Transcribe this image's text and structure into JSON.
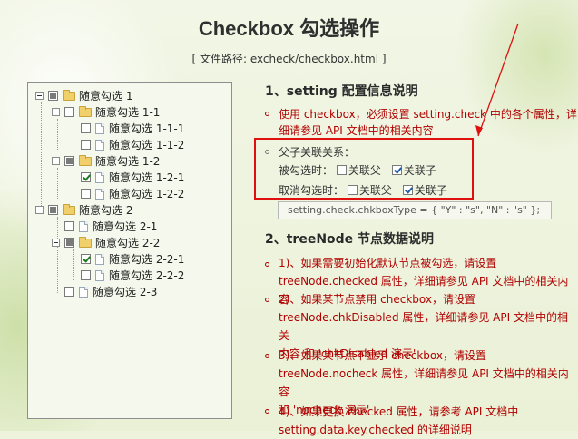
{
  "page": {
    "title": "Checkbox 勾选操作",
    "path": "[ 文件路径: excheck/checkbox.html ]"
  },
  "tree": {
    "nodes": [
      {
        "label": "随意勾选 1",
        "state": "partial",
        "folder": true
      },
      {
        "label": "随意勾选 1-1",
        "state": "unchecked",
        "folder": true
      },
      {
        "label": "随意勾选 1-1-1",
        "state": "unchecked",
        "folder": false
      },
      {
        "label": "随意勾选 1-1-2",
        "state": "unchecked",
        "folder": false
      },
      {
        "label": "随意勾选 1-2",
        "state": "partial",
        "folder": true
      },
      {
        "label": "随意勾选 1-2-1",
        "state": "checked",
        "folder": false
      },
      {
        "label": "随意勾选 1-2-2",
        "state": "unchecked",
        "folder": false
      },
      {
        "label": "随意勾选 2",
        "state": "partial",
        "folder": true
      },
      {
        "label": "随意勾选 2-1",
        "state": "unchecked",
        "folder": false
      },
      {
        "label": "随意勾选 2-2",
        "state": "partial",
        "folder": true
      },
      {
        "label": "随意勾选 2-2-1",
        "state": "checked",
        "folder": false
      },
      {
        "label": "随意勾选 2-2-2",
        "state": "unchecked",
        "folder": false
      },
      {
        "label": "随意勾选 2-3",
        "state": "unchecked",
        "folder": false
      }
    ]
  },
  "section1": {
    "title": "1、setting 配置信息说明",
    "item1_line1": "使用 checkbox，必须设置 setting.check 中的各个属性，详",
    "item1_line2": "细请参见 API 文档中的相关内容",
    "relation_title": "父子关联关系：",
    "checked_label": "被勾选时：",
    "unchecked_label": "取消勾选时：",
    "opt_parent": "关联父",
    "opt_child": "关联子",
    "code": "setting.check.chkboxType = { \"Y\" : \"s\", \"N\" : \"s\" };"
  },
  "options": {
    "checked_parent": false,
    "checked_child": true,
    "unchecked_parent": false,
    "unchecked_child": true
  },
  "section2": {
    "title": "2、treeNode 节点数据说明",
    "lines": [
      "1)、如果需要初始化默认节点被勾选，请设置",
      "treeNode.checked 属性，详细请参见 API 文档中的相关内容",
      "2)、如果某节点禁用 checkbox，请设置",
      "treeNode.chkDisabled 属性，详细请参见 API 文档中的相关",
      "内容 和 'chkDisabled 演示'",
      "3)、如果某节点不显示 checkbox，请设置",
      "treeNode.nocheck 属性，详细请参见 API 文档中的相关内容",
      "和 'nocheck 演示'",
      "4)、如果更换 checked 属性，请参考 API 文档中",
      "setting.data.key.checked 的详细说明"
    ]
  }
}
